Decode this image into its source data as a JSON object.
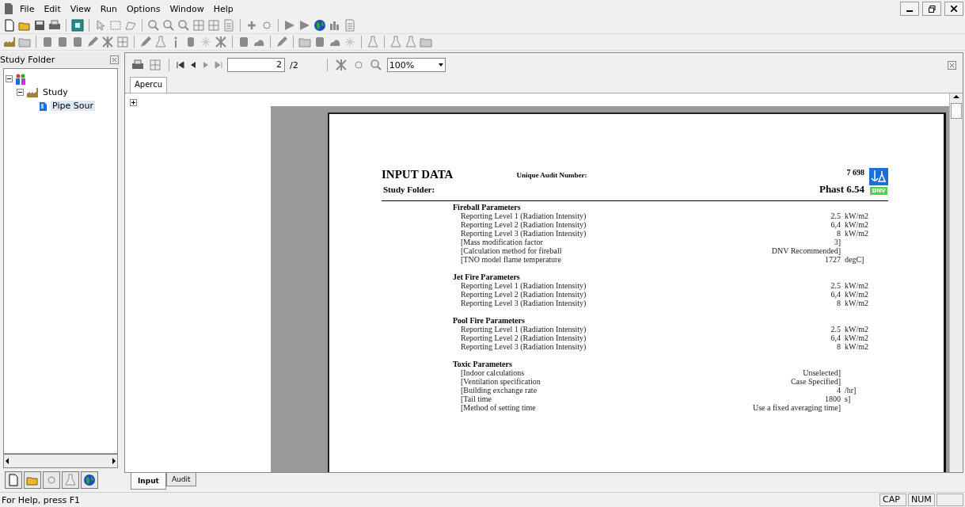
{
  "menu": [
    "File",
    "Edit",
    "View",
    "Run",
    "Options",
    "Window",
    "Help"
  ],
  "study_folder": {
    "title": "Study Folder",
    "tree": [
      {
        "expanded": true,
        "children": [
          {
            "label": "Study",
            "expanded": true,
            "selected": false,
            "children": [
              {
                "label": "Pipe Sour",
                "selected": true
              }
            ]
          }
        ]
      }
    ]
  },
  "preview_toolbar": {
    "page": "2",
    "page_count": "/2",
    "zoom": "100%"
  },
  "preview_tabs": [
    {
      "label": "Apercu",
      "selected": true
    }
  ],
  "report": {
    "title": "INPUT DATA",
    "audit_label": "Unique Audit Number:",
    "audit_number": "7 698",
    "folder_label": "Study Folder:",
    "version": "Phast 6.54",
    "logo_text": "DNV",
    "sections": [
      {
        "title": "Fireball Parameters",
        "rows": [
          {
            "label": "Reporting Level 1 (Radiation Intensity)",
            "value": "2.5",
            "unit": "kW/m2"
          },
          {
            "label": "Reporting Level 2 (Radiation Intensity)",
            "value": "6,4",
            "unit": "kW/m2"
          },
          {
            "label": "Reporting Level 3 (Radiation Intensity)",
            "value": "8",
            "unit": "kW/m2"
          },
          {
            "label": "[Mass modification factor",
            "value": "3]"
          },
          {
            "label": "[Calculation method for fireball",
            "value": "DNV Recommended]"
          },
          {
            "label": "[TNO model flame temperature",
            "value": "1727",
            "unit": "degC]"
          }
        ]
      },
      {
        "title": "Jet Fire Parameters",
        "rows": [
          {
            "label": "Reporting Level 1 (Radiation Intensity)",
            "value": "2.5",
            "unit": "kW/m2"
          },
          {
            "label": "Reporting Level 2 (Radiation Intensity)",
            "value": "6,4",
            "unit": "kW/m2"
          },
          {
            "label": "Reporting Level 3 (Radiation Intensity)",
            "value": "8",
            "unit": "kW/m2"
          }
        ]
      },
      {
        "title": "Pool Fire Parameters",
        "rows": [
          {
            "label": "Reporting Level 1 (Radiation Intensity)",
            "value": "2.5",
            "unit": "kW/m2"
          },
          {
            "label": "Reporting Level 2 (Radiation Intensity)",
            "value": "6,4",
            "unit": "kW/m2"
          },
          {
            "label": "Reporting Level 3 (Radiation Intensity)",
            "value": "8",
            "unit": "kW/m2"
          }
        ]
      },
      {
        "title": "Toxic Parameters",
        "rows": [
          {
            "label": "[Indoor calculations",
            "value": "Unselected]"
          },
          {
            "label": "[Ventilation specification",
            "value": "Case Specified]"
          },
          {
            "label": "[Building exchange rate",
            "value": "4",
            "unit": "/hr]"
          },
          {
            "label": "[Tail time",
            "value": "1800",
            "unit": "s]"
          },
          {
            "label": "[Method of setting time",
            "value": "Use a fixed averaging time]"
          }
        ]
      }
    ]
  },
  "bottom_tabs": [
    {
      "label": "Input",
      "selected": true
    },
    {
      "label": "Audit",
      "selected": false
    }
  ],
  "status_bar": {
    "message": "For Help, press F1",
    "indicators": [
      "CAP",
      "NUM"
    ]
  }
}
